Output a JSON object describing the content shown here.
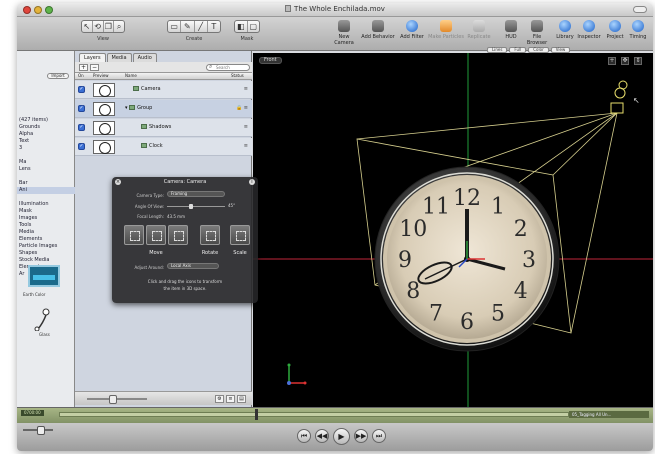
{
  "window": {
    "title": "The Whole Enchilada.mov"
  },
  "toolbar": {
    "groups": [
      {
        "id": "view",
        "label": "View",
        "tools": [
          "↖",
          "⟲",
          "❐",
          "⌕"
        ]
      },
      {
        "id": "create",
        "label": "Create",
        "tools": [
          "▭",
          "✎",
          "╱",
          "T"
        ]
      },
      {
        "id": "mask",
        "label": "Mask",
        "tools": [
          "◧",
          "▢"
        ]
      }
    ],
    "actions": [
      {
        "id": "new-camera",
        "label": "New Camera",
        "icon": "camera-icon",
        "style": "grey"
      },
      {
        "id": "add-behavior",
        "label": "Add Behavior",
        "icon": "gear-icon",
        "style": "grey"
      },
      {
        "id": "add-filter",
        "label": "Add Filter",
        "icon": "filter-icon",
        "style": "blue"
      },
      {
        "id": "make-particles",
        "label": "Make Particles",
        "icon": "particles-icon",
        "style": "orange"
      },
      {
        "id": "replicate",
        "label": "Replicate",
        "icon": "replicate-icon",
        "style": "dim"
      },
      {
        "id": "hud",
        "label": "HUD",
        "icon": "hud-icon",
        "style": "grey"
      },
      {
        "id": "file-browser",
        "label": "File Browser",
        "icon": "file-browser-icon",
        "style": "grey"
      },
      {
        "id": "library",
        "label": "Library",
        "icon": "library-icon",
        "style": "blue"
      },
      {
        "id": "inspector",
        "label": "Inspector",
        "icon": "inspector-icon",
        "style": "blue"
      },
      {
        "id": "project",
        "label": "Project",
        "icon": "project-icon",
        "style": "blue"
      },
      {
        "id": "timing",
        "label": "Timing",
        "icon": "timing-icon",
        "style": "blue"
      }
    ],
    "subbar": [
      "Lines",
      "Full",
      "Color",
      "View"
    ]
  },
  "library": {
    "button": "Import",
    "items": [
      "(427 items)",
      "Grounds",
      "Alpha",
      "Text",
      "3",
      "",
      "Ma",
      "Lens",
      "",
      "Bar",
      "Ani",
      "",
      "Illumination",
      "Mask",
      "Images",
      "Tools",
      "Media",
      "Elements"
    ],
    "selected_index": 10,
    "extra_items": [
      "Particle Images",
      "Shapes",
      "Stock Media",
      "Elements",
      "Ar"
    ],
    "preview_caption": "Earth Color",
    "swatch_caption": "Glass"
  },
  "layers_panel": {
    "tabs": [
      "Layers",
      "Media",
      "Audio"
    ],
    "active_tab": 0,
    "add_label": "+",
    "remove_label": "−",
    "search_placeholder": "Search",
    "columns": {
      "on": "On",
      "preview": "Preview",
      "name": "Name",
      "status": "Status"
    },
    "rows": [
      {
        "name": "Camera",
        "indent": 0,
        "status": "≡"
      },
      {
        "name": "Group",
        "indent": 0,
        "status": "🔒 ≡"
      },
      {
        "name": "Shadows",
        "indent": 1,
        "status": "≡"
      },
      {
        "name": "Clock",
        "indent": 1,
        "status": "≡"
      }
    ],
    "footer_buttons": [
      "⚙",
      "≡",
      "▤"
    ]
  },
  "hud": {
    "title": "Camera: Camera",
    "camera_type_label": "Camera Type:",
    "camera_type_value": "Framing",
    "angle_label": "Angle Of View:",
    "angle_value": "45°",
    "angle_fraction": 0.42,
    "focal_label": "Focal Length:",
    "focal_value": "43.5 mm",
    "tools": [
      {
        "label": "Move",
        "group": 0
      },
      {
        "label": "Rotate",
        "group": 1
      },
      {
        "label": "Scale",
        "group": 2
      }
    ],
    "adjust_label": "Adjust Around:",
    "adjust_value": "Local Axis",
    "footer_line1": "Click and drag the icons to transform",
    "footer_line2": "the item in 3D space."
  },
  "canvas": {
    "view_label": "Front",
    "view_icons": [
      "+",
      "✥",
      "⇕"
    ],
    "clock_numbers": [
      "12",
      "1",
      "2",
      "3",
      "4",
      "5",
      "6",
      "7",
      "8",
      "9",
      "10",
      "11"
    ]
  },
  "timeline": {
    "left_label": "0700:00",
    "right_label": "05_Tagging All Un..."
  },
  "transport": {
    "buttons": [
      "⏮",
      "◀◀",
      "▶",
      "▶▶",
      "⏭"
    ]
  }
}
